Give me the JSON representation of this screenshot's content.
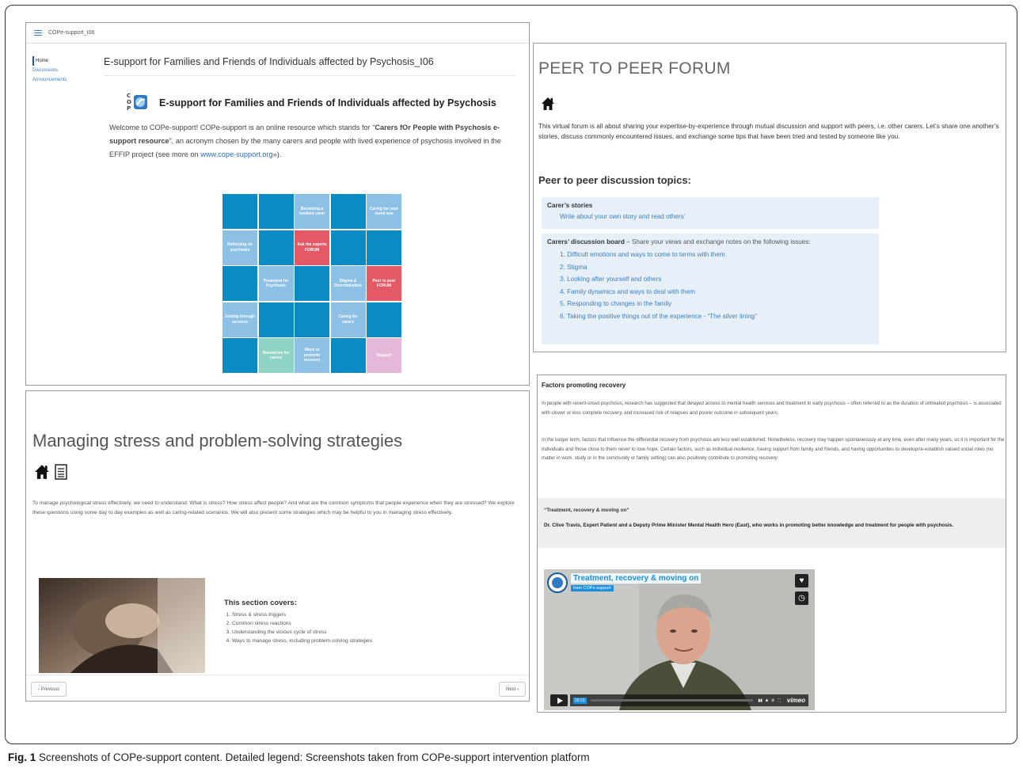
{
  "panel1": {
    "site_title": "COPe-support_I06",
    "sidebar": [
      "Home",
      "Discussions",
      "Announcements"
    ],
    "title": "E-support for Families and Friends of Individuals affected by Psychosis_I06",
    "heading": "E-support for Families and Friends of Individuals affected by Psychosis",
    "intro_a": "Welcome to COPe-support! COPe-support is an online resource which stands for “",
    "intro_bold": "Carers fOr People with Psychosis e-support resource",
    "intro_b": "”, an acronym chosen by the many carers and people with lived experience of psychosis involved in the EFFIP project (see more on ",
    "intro_link": "www.cope-support.org",
    "intro_c": "»).",
    "grid": [
      {
        "label": "",
        "kind": "blue"
      },
      {
        "label": "",
        "kind": "blue"
      },
      {
        "label": "Becoming a resilient carer",
        "kind": "lb"
      },
      {
        "label": "",
        "kind": "blue"
      },
      {
        "label": "Caring for your loved one",
        "kind": "lb"
      },
      {
        "label": "Reflecting on psychosis",
        "kind": "lb"
      },
      {
        "label": "",
        "kind": "blue"
      },
      {
        "label": "Ask the experts FORUM",
        "kind": "red"
      },
      {
        "label": "",
        "kind": "blue"
      },
      {
        "label": "",
        "kind": "blue"
      },
      {
        "label": "",
        "kind": "blue"
      },
      {
        "label": "Treatment for Psychosis",
        "kind": "lb"
      },
      {
        "label": "",
        "kind": "blue"
      },
      {
        "label": "Stigma & Discrimination",
        "kind": "lb"
      },
      {
        "label": "Peer to peer FORUM",
        "kind": "red"
      },
      {
        "label": "Getting through services",
        "kind": "lb"
      },
      {
        "label": "",
        "kind": "blue"
      },
      {
        "label": "",
        "kind": "blue"
      },
      {
        "label": "Caring for carers",
        "kind": "lb"
      },
      {
        "label": "",
        "kind": "blue"
      },
      {
        "label": "",
        "kind": "blue"
      },
      {
        "label": "Resources for carers",
        "kind": "mint"
      },
      {
        "label": "Ways to promote recovery",
        "kind": "lb"
      },
      {
        "label": "",
        "kind": "blue"
      },
      {
        "label": "Support",
        "kind": "pink"
      }
    ]
  },
  "panel2": {
    "title": "PEER TO PEER FORUM",
    "home_icon": "home-icon",
    "description": "This virtual forum is all about sharing your expertise-by-experience through mutual discussion and support with peers, i.e. other carers. Let’s share one another’s stories, discuss commonly encountered issues, and exchange some tips that have been tried and tested by someone like you.",
    "section_heading": "Peer to peer discussion topics:",
    "stories_title": "Carer’s stories",
    "stories_link": "Write about your own story and read others’",
    "board_title": "Carers’ discussion board",
    "board_desc": " – Share your views and exchange notes on the following issues:",
    "topics": [
      "1. Difficult emotions and ways to come to terms with them",
      "2. Stigma",
      "3. Looking after yourself and others",
      "4. Family dynamics and ways to deal with them",
      "5. Responding to changes in the family",
      "6. Taking the positive things out of the experience - “The silver lining”"
    ]
  },
  "panel3": {
    "title": "Managing stress and problem-solving strategies",
    "icons": [
      "home-icon",
      "list-icon"
    ],
    "description": "To manage psychological stress effectively, we need to understand: What is stress? How stress affect people? And what are the common symptoms that people experience when they are stressed? We explore these questions using some day to day examples as well as caring-related scenarios. We will also present some strategies which may be helpful to you in managing stress effectively.",
    "covers_title": "This section covers:",
    "covers_items": [
      "Stress & stress triggers",
      "Common stress reactions",
      "Understanding the vicious cycle of stress",
      "Ways to manage stress, including problem-solving strategies"
    ],
    "prev_label": "‹ Previous",
    "next_label": "Next ›"
  },
  "panel4": {
    "title": "Factors promoting recovery",
    "para1": "In people with recent-onset psychosis, research has suggested that delayed access to mental health services and treatment in early psychosis – often referred to as the duration of untreated psychosis – is associated with slower or less complete recovery, and increased risk of relapses and poorer outcome in subsequent years.",
    "para2": "In the longer term, factors that influence the differential recovery from psychosis are less well established. Nonetheless, recovery may happen spontaneously at any time, even after many years, so it is important for the individuals and those close to them never to lose hope. Certain factors, such as individual resilience, having support from family and friends, and having opportunities to develop/re-establish valued social roles (no matter in work, study or in the community or family setting) can also positively contribute to promoting recovery.",
    "quote_title": "“Treatment, recovery & moving on”",
    "quote_body": "Dr. Clive Travis, Expert Patient and a Deputy Prime Minister Mental Health Hero (East), who works in promoting better knowledge and treatment for people with psychosis.",
    "video_title": "Treatment, recovery & moving on",
    "video_from": "from COPe-support",
    "video_time": "03:23",
    "video_brand": "vimeo"
  },
  "caption": {
    "label": "Fig. 1",
    "text": " Screenshots of COPe-support content. Detailed legend: Screenshots taken from COPe-support intervention platform"
  }
}
